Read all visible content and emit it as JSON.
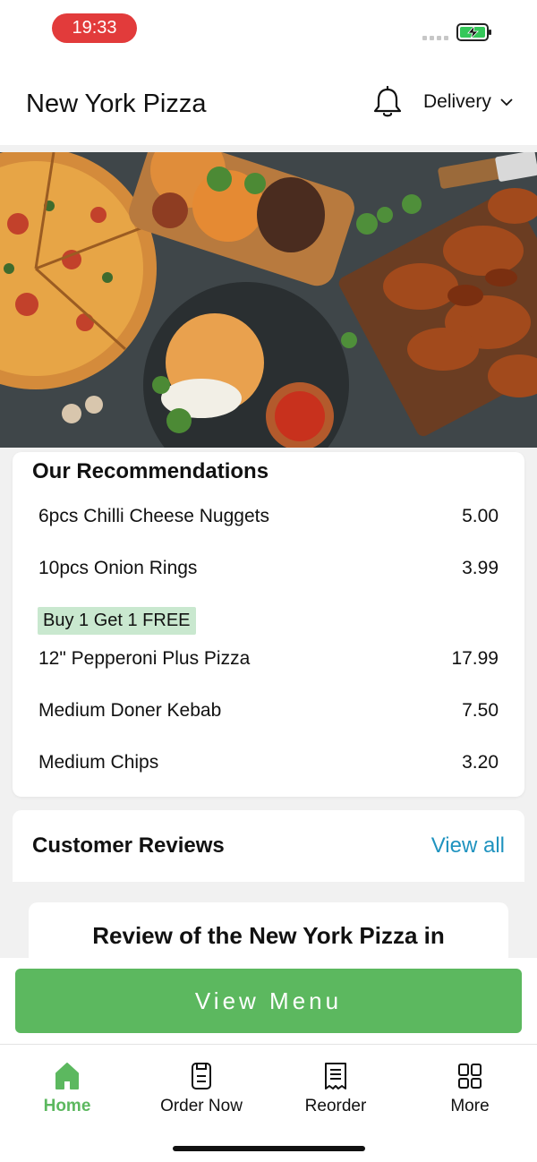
{
  "status": {
    "time": "19:33"
  },
  "header": {
    "title": "New York Pizza",
    "mode": "Delivery"
  },
  "recommendations": {
    "title": "Our Recommendations",
    "promo": "Buy 1 Get 1 FREE",
    "items": [
      {
        "name": "6pcs Chilli Cheese Nuggets",
        "price": "5.00"
      },
      {
        "name": "10pcs Onion Rings",
        "price": "3.99"
      },
      {
        "name": "12\" Pepperoni Plus Pizza",
        "price": "17.99"
      },
      {
        "name": "Medium Doner Kebab",
        "price": "7.50"
      },
      {
        "name": "Medium Chips",
        "price": "3.20"
      }
    ]
  },
  "reviews": {
    "title": "Customer Reviews",
    "view_all": "View all",
    "first_title": "Review of the New York Pizza in"
  },
  "cta": {
    "label": "View Menu"
  },
  "tabs": [
    {
      "label": "Home",
      "icon": "home-icon"
    },
    {
      "label": "Order Now",
      "icon": "order-icon"
    },
    {
      "label": "Reorder",
      "icon": "receipt-icon"
    },
    {
      "label": "More",
      "icon": "grid-icon"
    }
  ],
  "colors": {
    "accent": "#5cb85f",
    "link": "#1f93bf",
    "time_pill": "#e23b3b",
    "promo_bg": "#c9e8cf"
  }
}
